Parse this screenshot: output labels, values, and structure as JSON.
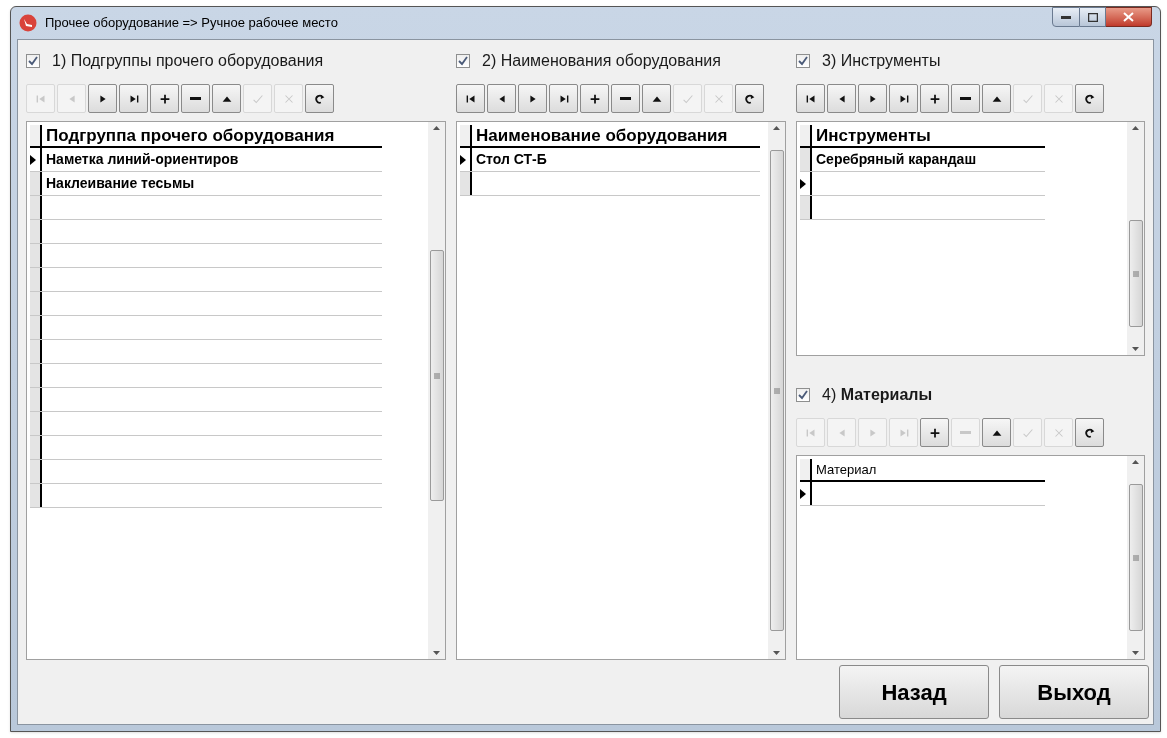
{
  "window": {
    "title": "Прочее оборудование => Ручное рабочее место"
  },
  "panels": [
    {
      "checked": true,
      "title": "1) Подгруппы прочего оборудования",
      "navigator": [
        {
          "kind": "first",
          "disabled": true
        },
        {
          "kind": "prior",
          "disabled": true
        },
        {
          "kind": "next",
          "disabled": false
        },
        {
          "kind": "last",
          "disabled": false
        },
        {
          "kind": "insert",
          "disabled": false
        },
        {
          "kind": "delete",
          "disabled": false
        },
        {
          "kind": "edit",
          "disabled": false
        },
        {
          "kind": "post",
          "disabled": true
        },
        {
          "kind": "cancel",
          "disabled": true
        },
        {
          "kind": "refresh",
          "disabled": false
        }
      ],
      "grid": {
        "column": "Подгруппа прочего оборудования",
        "header_bold": true,
        "rows": [
          {
            "current": true,
            "cell": "Наметка линий-ориентиров"
          },
          {
            "current": false,
            "cell": "Наклеивание тесьмы"
          },
          {
            "current": false
          },
          {
            "current": false
          },
          {
            "current": false
          },
          {
            "current": false
          },
          {
            "current": false
          },
          {
            "current": false
          },
          {
            "current": false
          },
          {
            "current": false
          },
          {
            "current": false
          },
          {
            "current": false
          },
          {
            "current": false
          },
          {
            "current": false
          },
          {
            "current": false
          }
        ]
      }
    },
    {
      "checked": true,
      "title": "2) Наименования оборудования",
      "navigator": [
        {
          "kind": "first",
          "disabled": false
        },
        {
          "kind": "prior",
          "disabled": false
        },
        {
          "kind": "next",
          "disabled": false
        },
        {
          "kind": "last",
          "disabled": false
        },
        {
          "kind": "insert",
          "disabled": false
        },
        {
          "kind": "delete",
          "disabled": false
        },
        {
          "kind": "edit",
          "disabled": false
        },
        {
          "kind": "post",
          "disabled": true
        },
        {
          "kind": "cancel",
          "disabled": true
        },
        {
          "kind": "refresh",
          "disabled": false
        }
      ],
      "grid": {
        "column": "Наименование оборудования",
        "header_bold": true,
        "rows": [
          {
            "current": true,
            "cell": "Стол СТ-Б"
          },
          {
            "current": false
          }
        ]
      }
    },
    {
      "checked": true,
      "title": "3) Инструменты",
      "navigator": [
        {
          "kind": "first",
          "disabled": false
        },
        {
          "kind": "prior",
          "disabled": false
        },
        {
          "kind": "next",
          "disabled": false
        },
        {
          "kind": "last",
          "disabled": false
        },
        {
          "kind": "insert",
          "disabled": false
        },
        {
          "kind": "delete",
          "disabled": false
        },
        {
          "kind": "edit",
          "disabled": false
        },
        {
          "kind": "post",
          "disabled": true
        },
        {
          "kind": "cancel",
          "disabled": true
        },
        {
          "kind": "refresh",
          "disabled": false
        }
      ],
      "grid": {
        "column": "Инструменты",
        "header_bold": true,
        "rows": [
          {
            "current": false,
            "cell": "Серебряный карандаш"
          },
          {
            "current": true
          },
          {
            "current": false
          }
        ]
      }
    },
    {
      "checked": true,
      "title": "4) **Материалы**",
      "navigator": [
        {
          "kind": "first",
          "disabled": true
        },
        {
          "kind": "prior",
          "disabled": true
        },
        {
          "kind": "next",
          "disabled": true
        },
        {
          "kind": "last",
          "disabled": true
        },
        {
          "kind": "insert",
          "disabled": false
        },
        {
          "kind": "delete",
          "disabled": true
        },
        {
          "kind": "edit",
          "disabled": false
        },
        {
          "kind": "post",
          "disabled": true
        },
        {
          "kind": "cancel",
          "disabled": true
        },
        {
          "kind": "refresh",
          "disabled": false
        }
      ],
      "grid": {
        "column": "Материал",
        "header_bold": false,
        "rows": [
          {
            "current": true
          }
        ]
      }
    }
  ],
  "buttons": [
    "Назад",
    "Выход"
  ]
}
